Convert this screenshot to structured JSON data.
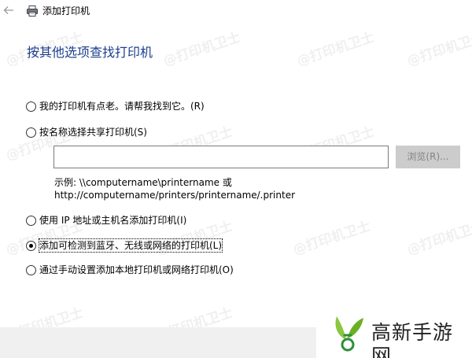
{
  "window": {
    "title": "添加打印机"
  },
  "heading": "按其他选项查找打印机",
  "options": [
    {
      "label": "我的打印机有点老。请帮我找到它。(R)",
      "checked": false
    },
    {
      "label": "按名称选择共享打印机(S)",
      "checked": false
    },
    {
      "label": "使用 IP 地址或主机名添加打印机(I)",
      "checked": false
    },
    {
      "label": "添加可检测到蓝牙、无线或网络的打印机(L)",
      "checked": true
    },
    {
      "label": "通过手动设置添加本地打印机或网络打印机(O)",
      "checked": false
    }
  ],
  "shared_printer": {
    "input_value": "",
    "browse_label": "浏览(R)...",
    "example_line1": "示例: \\\\computername\\printername 或",
    "example_line2": "http://computername/printers/printername/.printer"
  },
  "watermark": "@打印机卫士",
  "brand": {
    "name": "高新手游网"
  },
  "colors": {
    "heading": "#1b3f8f",
    "footer_bar": "#f0f0f0",
    "brand_green": "#8cc63f"
  },
  "icons": {
    "back": "back-arrow-icon",
    "printer": "printer-icon",
    "brand": "brand-logo-icon"
  }
}
